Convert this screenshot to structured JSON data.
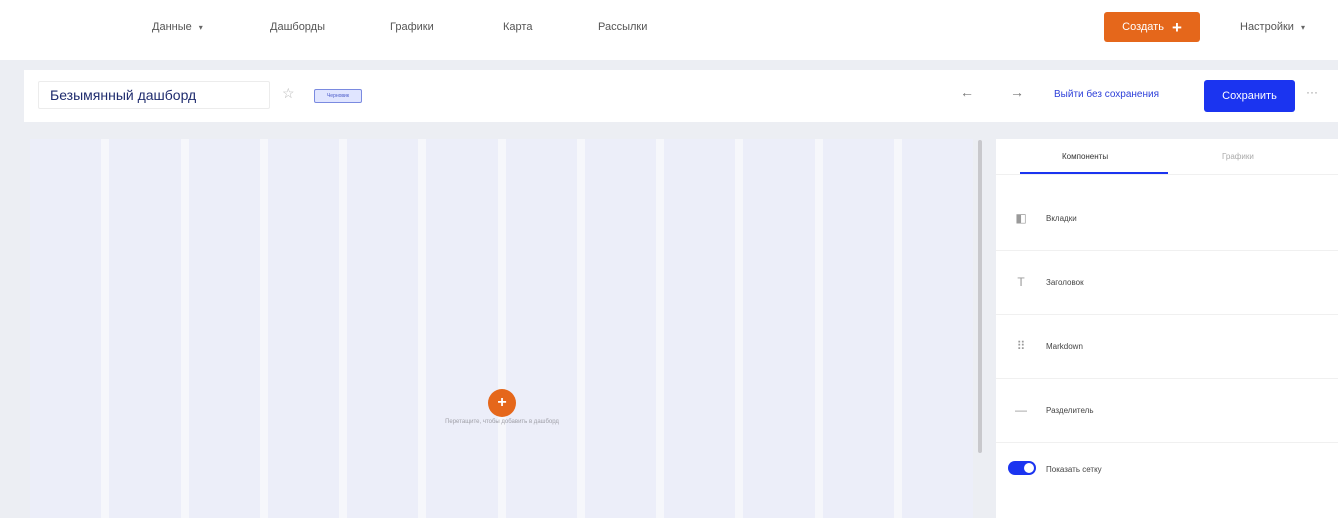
{
  "nav": {
    "items": [
      {
        "label": "Данные",
        "caret": "▾"
      },
      {
        "label": "Дашборды"
      },
      {
        "label": "Графики"
      },
      {
        "label": "Карта"
      },
      {
        "label": "Рассылки"
      }
    ],
    "create_label": "Создать",
    "create_icon": "+",
    "settings_label": "Настройки",
    "settings_caret": "▾"
  },
  "header": {
    "title_value": "Безымянный дашборд",
    "star_icon": "☆",
    "draft_badge": "Черновик",
    "back_icon": "←",
    "forward_icon": "→",
    "exit_label": "Выйти без сохранения",
    "save_label": "Сохранить",
    "more_icon": "···"
  },
  "canvas": {
    "add_icon": "+",
    "drop_hint": "Перетащите, чтобы добавить в дашборд"
  },
  "panel": {
    "tabs": [
      {
        "label": "Компоненты",
        "active": true
      },
      {
        "label": "Графики",
        "active": false
      }
    ],
    "components": [
      {
        "label": "Вкладки",
        "icon": "tabs-icon",
        "glyph": "◧"
      },
      {
        "label": "Заголовок",
        "icon": "heading-icon",
        "glyph": "T"
      },
      {
        "label": "Markdown",
        "icon": "markdown-icon",
        "glyph": "⠿"
      },
      {
        "label": "Разделитель",
        "icon": "divider-icon",
        "glyph": "—"
      }
    ],
    "show_grid_label": "Показать сетку",
    "show_grid_on": true
  },
  "colors": {
    "accent_orange": "#e5671b",
    "accent_blue": "#1b34f0",
    "title_navy": "#1f2c6e"
  }
}
